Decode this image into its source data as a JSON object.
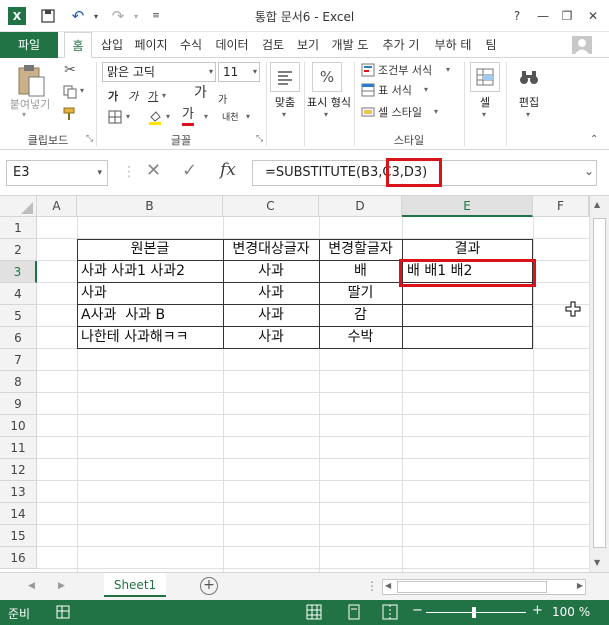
{
  "window": {
    "title": "통합 문서6 - Excel",
    "help": "?",
    "minimize": "—",
    "restore": "❐",
    "close": "✕",
    "brand_color": "#217346"
  },
  "ribbon_tabs": [
    "파일",
    "홈",
    "삽입",
    "페이지",
    "수식",
    "데이터",
    "검토",
    "보기",
    "개발 도",
    "추가 기",
    "부하 테",
    "팀"
  ],
  "ribbon": {
    "clipboard": {
      "paste": "붙여넣기",
      "label": "클립보드"
    },
    "font": {
      "font_name": "맑은 고딕",
      "font_size": "11",
      "bold": "가",
      "italic": "가",
      "underline": "가",
      "grow": "가",
      "shrink": "가",
      "color_a": "가",
      "phonetic": "내천",
      "label": "글꼴"
    },
    "alignment": {
      "label": "맞춤"
    },
    "number": {
      "label": "표시 형식",
      "percent": "%"
    },
    "styles": {
      "conditional": "조건부 서식",
      "table": "표 서식",
      "cell_style": "셀 스타일",
      "label": "스타일"
    },
    "cells": {
      "label": "셀"
    },
    "editing": {
      "label": "편집"
    }
  },
  "formula_bar": {
    "name_box": "E3",
    "cancel": "✕",
    "enter": "✓",
    "fx": "fx",
    "formula": "=SUBSTITUTE(B3,C3,D3)"
  },
  "columns": [
    "A",
    "B",
    "C",
    "D",
    "E",
    "F"
  ],
  "rows": [
    "1",
    "2",
    "3",
    "4",
    "5",
    "6",
    "7",
    "8",
    "9",
    "10",
    "11",
    "12",
    "13",
    "14",
    "15",
    "16"
  ],
  "table": {
    "headers": [
      "원본글",
      "변경대상글자",
      "변경할글자",
      "결과"
    ],
    "rows": [
      [
        "사과 사과1 사과2",
        "사과",
        "배",
        "배 배1 배2"
      ],
      [
        "사과",
        "사과",
        "딸기",
        ""
      ],
      [
        "A사과  사과 B",
        "사과",
        "감",
        ""
      ],
      [
        "나한테 사과해ㅋㅋ",
        "사과",
        "수박",
        ""
      ]
    ]
  },
  "sheet": {
    "tab": "Sheet1",
    "add": "+"
  },
  "status": {
    "ready": "준비",
    "zoom": "100 %",
    "zoom_minus": "−",
    "zoom_plus": "+"
  },
  "highlight_color": "#d9121b"
}
